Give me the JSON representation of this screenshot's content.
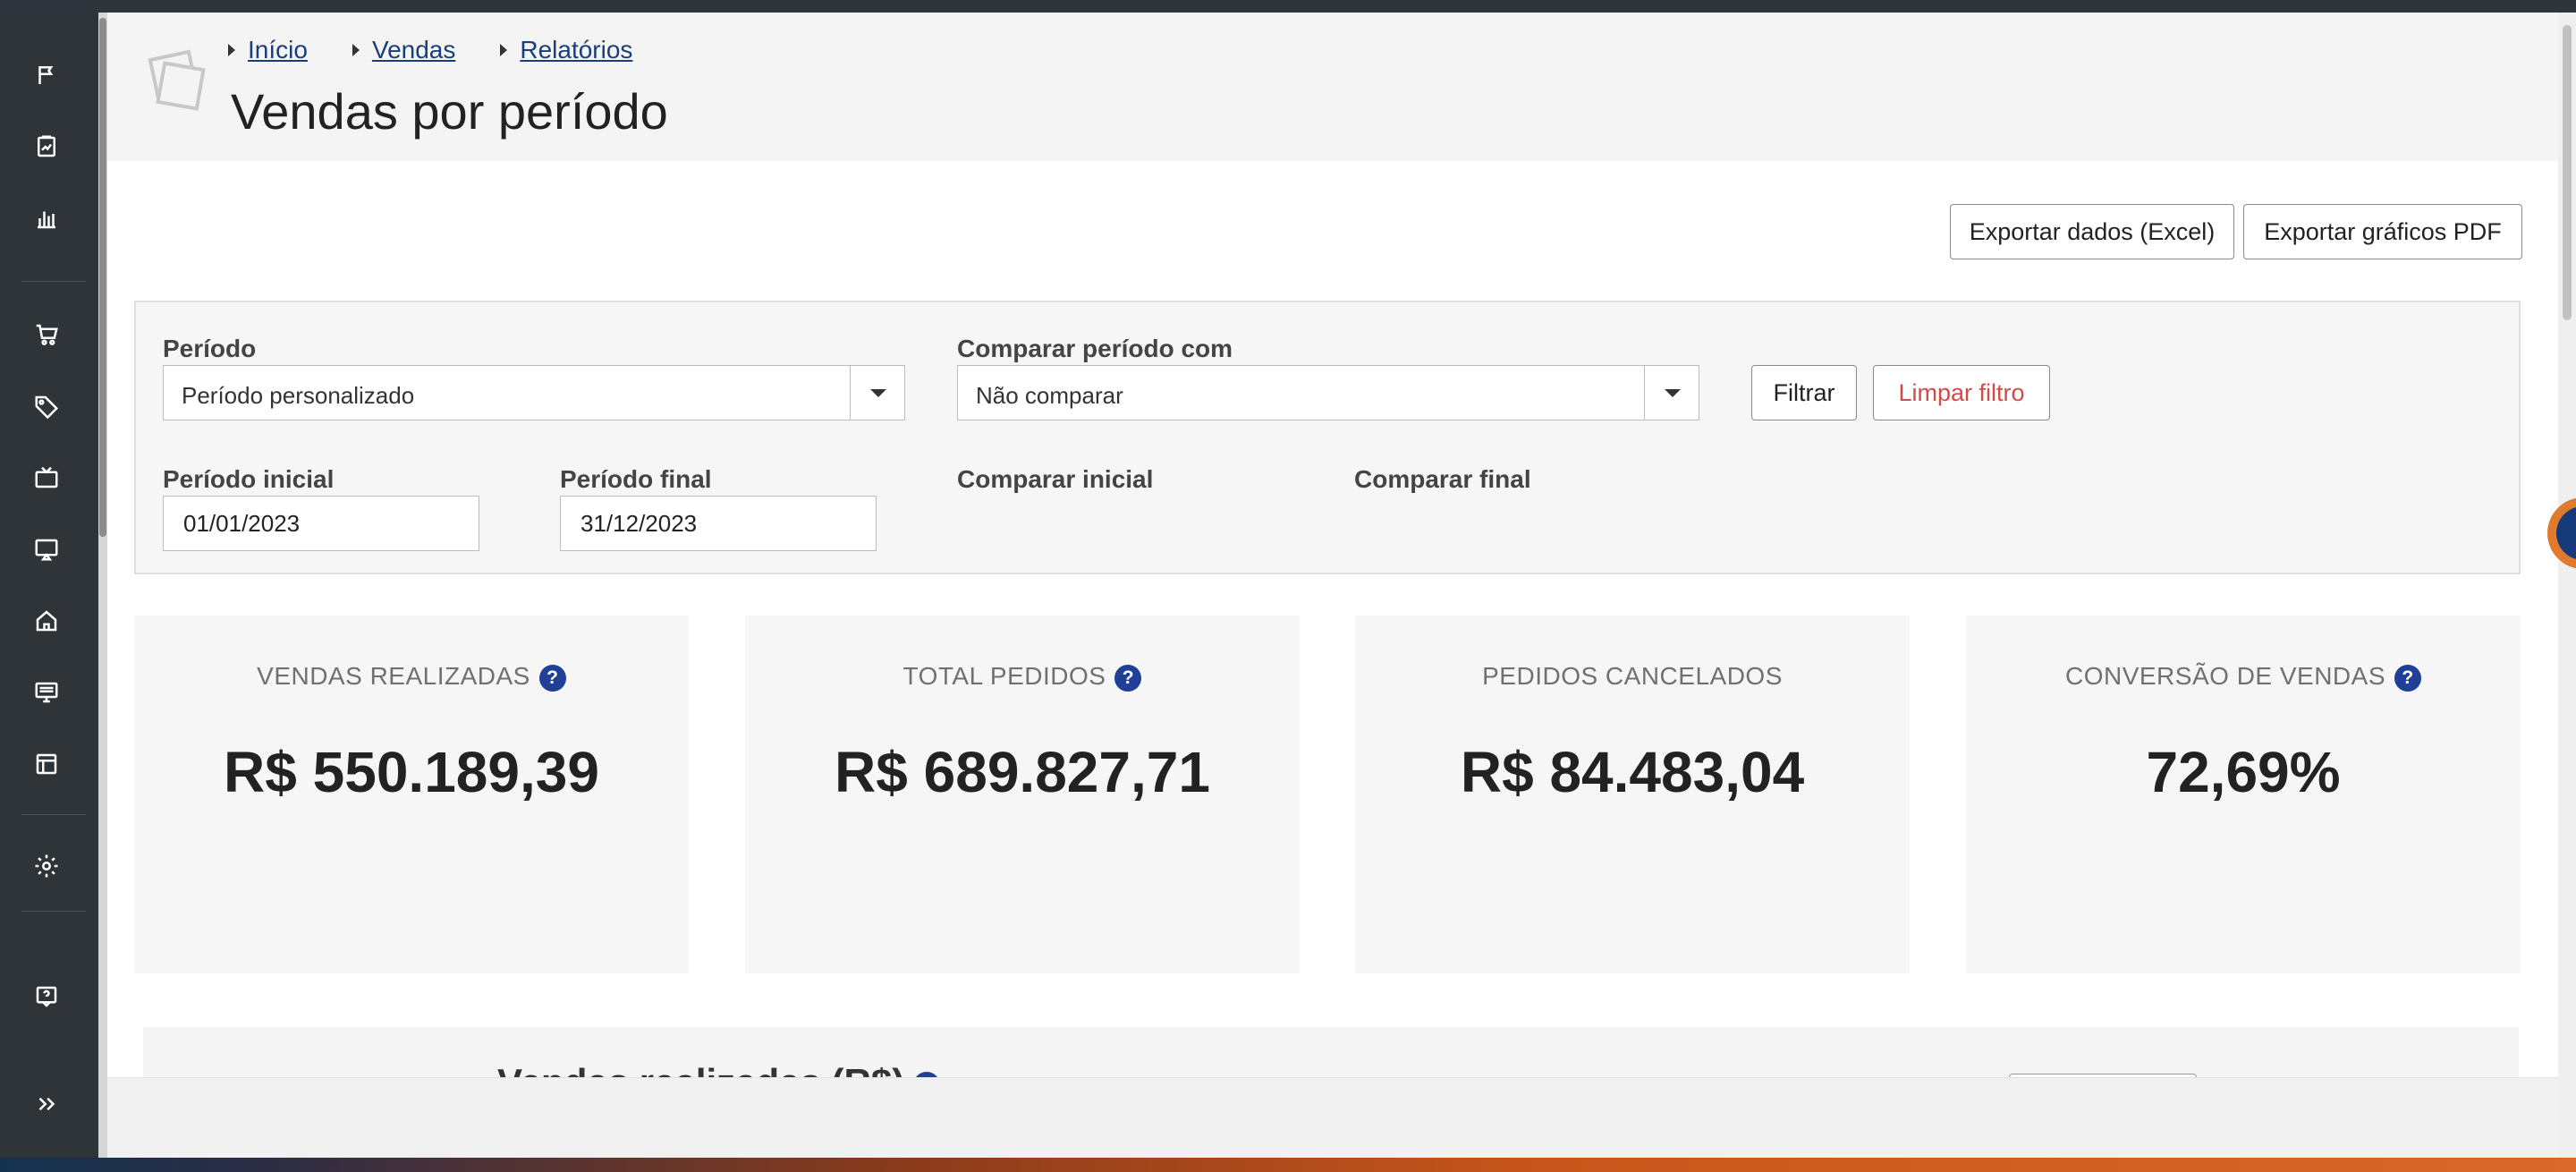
{
  "breadcrumb": [
    "Início",
    "Vendas",
    "Relatórios"
  ],
  "page_title": "Vendas por período",
  "toolbar": {
    "export_excel": "Exportar dados (Excel)",
    "export_pdf": "Exportar gráficos PDF"
  },
  "filters": {
    "periodo_label": "Período",
    "periodo_value": "Período personalizado",
    "comparar_label": "Comparar período com",
    "comparar_value": "Não comparar",
    "filtrar_button": "Filtrar",
    "limpar_button": "Limpar filtro",
    "inicial_label": "Período inicial",
    "inicial_value": "01/01/2023",
    "final_label": "Período final",
    "final_value": "31/12/2023",
    "comparar_inicial_label": "Comparar inicial",
    "comparar_final_label": "Comparar final"
  },
  "cards": [
    {
      "title": "VENDAS REALIZADAS",
      "value": "R$ 550.189,39",
      "help": "?"
    },
    {
      "title": "TOTAL PEDIDOS",
      "value": "R$ 689.827,71",
      "help": "?"
    },
    {
      "title": "PEDIDOS CANCELADOS",
      "value": "R$ 84.483,04"
    },
    {
      "title": "CONVERSÃO DE VENDAS",
      "value": "72,69%",
      "help": "?"
    }
  ],
  "chart_section": {
    "title": "Vendas realizadas (R$)",
    "help": "?"
  },
  "sidebar_icons": [
    "flag-icon",
    "clipboard-chart-icon",
    "bar-chart-icon",
    "cart-icon",
    "tag-icon",
    "tv-icon",
    "screen-cast-icon",
    "home-icon",
    "monitor-icon",
    "layout-icon",
    "gear-icon",
    "help-chat-icon",
    "expand-icon"
  ],
  "colors": {
    "link": "#1a3d7c",
    "help_badge": "#203f96",
    "danger": "#d24b45",
    "sidebar": "#2f3439"
  }
}
